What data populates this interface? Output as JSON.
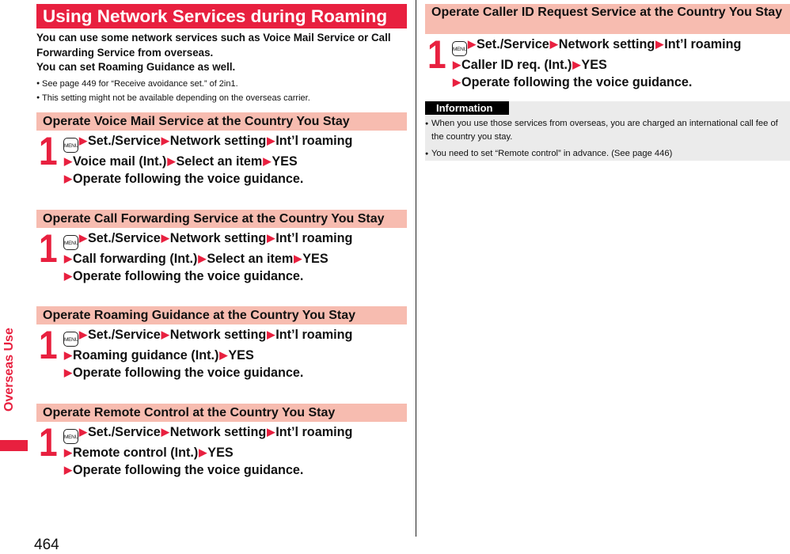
{
  "page": {
    "number": "464",
    "side_tab_label": "Overseas Use",
    "accent_color": "#e8203f",
    "section_bg_color": "#f7bcb0",
    "info_bg_color": "#ebebeb"
  },
  "left": {
    "title": "Using Network Services during Roaming",
    "intro": [
      "You can use some network services such as Voice Mail Service or Call Forwarding Service from overseas.",
      "You can set Roaming Guidance as well."
    ],
    "bullets": [
      "See page 449 for “Receive avoidance set.” of 2in1.",
      "This setting might not be available depending on the overseas carrier."
    ],
    "sections": [
      {
        "heading": "Operate Voice Mail Service at the Country You Stay",
        "step_number": "1",
        "menu_key": "MENU",
        "path_line1": [
          "Set./Service",
          "Network setting",
          "Int’l roaming"
        ],
        "path_line2": [
          "Voice mail (Int.)",
          "Select an item",
          "YES"
        ],
        "path_line3": [
          "Operate following the voice guidance."
        ]
      },
      {
        "heading": "Operate Call Forwarding Service at the Country You Stay",
        "step_number": "1",
        "menu_key": "MENU",
        "path_line1": [
          "Set./Service",
          "Network setting",
          "Int’l roaming"
        ],
        "path_line2": [
          "Call forwarding (Int.)",
          "Select an item",
          "YES"
        ],
        "path_line3": [
          "Operate following the voice guidance."
        ]
      },
      {
        "heading": "Operate Roaming Guidance at the Country You Stay",
        "step_number": "1",
        "menu_key": "MENU",
        "path_line1": [
          "Set./Service",
          "Network setting",
          "Int’l roaming"
        ],
        "path_line2": [
          "Roaming guidance (Int.)",
          "YES"
        ],
        "path_line3": [
          "Operate following the voice guidance."
        ]
      },
      {
        "heading": "Operate Remote Control at the Country You Stay",
        "step_number": "1",
        "menu_key": "MENU",
        "path_line1": [
          "Set./Service",
          "Network setting",
          "Int’l roaming"
        ],
        "path_line2": [
          "Remote control (Int.)",
          "YES"
        ],
        "path_line3": [
          "Operate following the voice guidance."
        ]
      }
    ]
  },
  "right": {
    "section": {
      "heading": "Operate Caller ID Request Service at the Country You Stay",
      "step_number": "1",
      "menu_key": "MENU",
      "path_line1": [
        "Set./Service",
        "Network setting",
        "Int’l roaming"
      ],
      "path_line2": [
        "Caller ID req. (Int.)",
        "YES"
      ],
      "path_line3": [
        "Operate following the voice guidance."
      ]
    },
    "information": {
      "label": "Information",
      "items": [
        "When you use those services from overseas, you are charged an international call fee of the country you stay.",
        "You need to set “Remote control” in advance. (See page 446)"
      ]
    }
  }
}
